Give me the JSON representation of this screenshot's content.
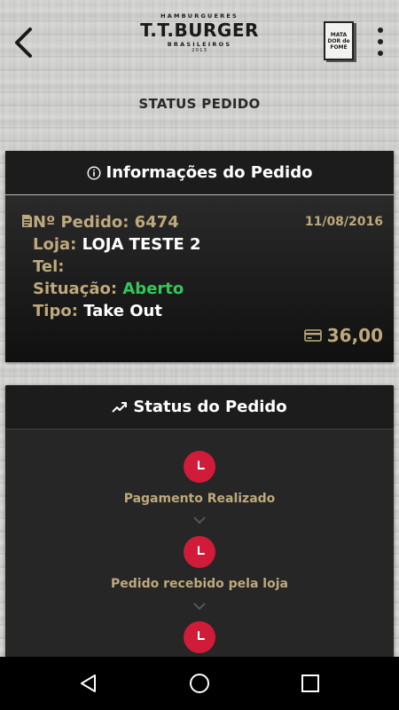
{
  "app": {
    "brand_top": "HAMBURGUERES",
    "brand_name": "T.T.BURGER",
    "brand_bottom": "BRASILEIROS",
    "brand_year": "2013",
    "book_lines": [
      "MATA",
      "DOR de",
      "FOME"
    ]
  },
  "page": {
    "title": "STATUS PEDIDO"
  },
  "order_info": {
    "header": "Informações do Pedido",
    "order_label": "Nº Pedido:",
    "order_number": "6474",
    "date": "11/08/2016",
    "store_label": "Loja:",
    "store_value": "LOJA TESTE 2",
    "phone_label": "Tel:",
    "phone_value": "",
    "status_label": "Situação:",
    "status_value": "Aberto",
    "type_label": "Tipo:",
    "type_value": "Take Out",
    "total": "36,00"
  },
  "order_status": {
    "header": "Status do Pedido",
    "steps": [
      {
        "label": "Pagamento Realizado",
        "icon": "clock-icon"
      },
      {
        "label": "Pedido recebido pela loja",
        "icon": "clock-icon"
      },
      {
        "label": "",
        "icon": "clock-icon"
      }
    ]
  },
  "colors": {
    "gold": "#bda97c",
    "green": "#33c75a",
    "red": "#d01c39"
  },
  "icons": [
    "back-arrow-icon",
    "book-icon",
    "overflow-menu-icon",
    "info-icon",
    "document-icon",
    "credit-card-icon",
    "trending-up-icon",
    "clock-icon",
    "chevron-down-icon",
    "nav-back-icon",
    "nav-home-icon",
    "nav-recents-icon"
  ]
}
